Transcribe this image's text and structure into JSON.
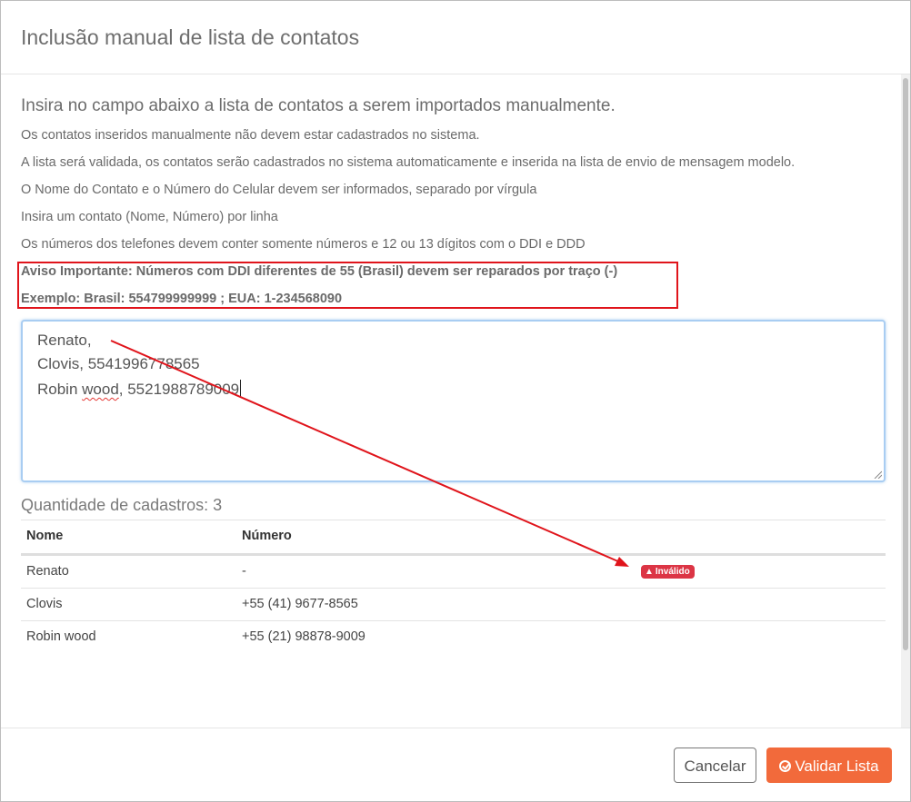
{
  "modal": {
    "title": "Inclusão manual de lista de contatos"
  },
  "instructions": {
    "lead": "Insira no campo abaixo a lista de contatos a serem importados manualmente.",
    "lines": [
      "Os contatos inseridos manualmente não devem estar cadastrados no sistema.",
      "A lista será validada, os contatos serão cadastrados no sistema automaticamente e inserida na lista de envio de mensagem modelo.",
      "O Nome do Contato e o Número do Celular devem ser informados, separado por vírgula",
      "Insira um contato (Nome, Número) por linha",
      "Os números dos telefones devem conter somente números e 12 ou 13 dígitos com o DDI e DDD"
    ],
    "warning": "Aviso Importante: Números com DDI diferentes de 55 (Brasil) devem ser reparados por traço (-)",
    "example": "Exemplo: Brasil: 554799999999 ; EUA: 1-234568090"
  },
  "textarea": {
    "line1": "Renato,",
    "line2": "Clovis, 5541996778565",
    "line3_a": "Robin ",
    "line3_b": "wood",
    "line3_c": ", 5521988789009"
  },
  "summary": {
    "count_label": "Quantidade de cadastros: 3"
  },
  "table": {
    "headers": [
      "Nome",
      "Número"
    ],
    "rows": [
      {
        "name": "Renato",
        "number": "-",
        "badge": "Inválido"
      },
      {
        "name": "Clovis",
        "number": "+55 (41) 9677-8565"
      },
      {
        "name": "Robin wood",
        "number": "+55 (21) 98878-9009"
      }
    ]
  },
  "footer": {
    "cancel_label": "Cancelar",
    "validate_label": "Validar Lista"
  },
  "icons": {
    "badge_icon": "warning-triangle-icon",
    "validate_icon": "check-circle-icon"
  },
  "colors": {
    "annotation_red": "#e0141b",
    "badge_red": "#dc3545",
    "primary_orange": "#f26a3b",
    "focus_blue": "#a9cdf2"
  }
}
